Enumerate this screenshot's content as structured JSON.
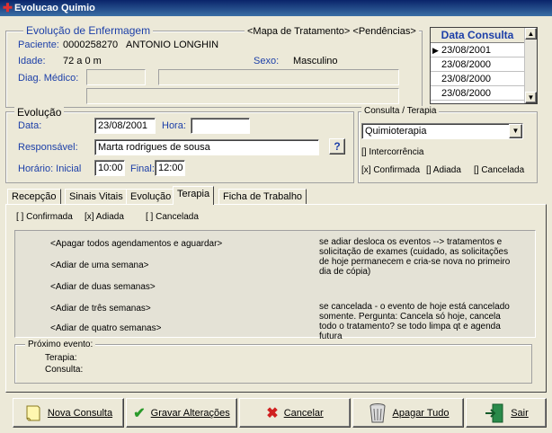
{
  "window": {
    "title": "Evolucao Quimio"
  },
  "header": {
    "section_title": "Evolução de Enfermagem",
    "links": "<Mapa de Tratamento> <Pendências>",
    "patient_label": "Paciente:",
    "patient_id": "0000258270",
    "patient_name": "ANTONIO LONGHIN",
    "age_label": "Idade:",
    "age_value": "72 a 0 m",
    "sex_label": "Sexo:",
    "sex_value": "Masculino",
    "diag_label": "Diag. Médico:"
  },
  "data_consulta": {
    "header": "Data Consulta",
    "rows": [
      "23/08/2001",
      "23/08/2000",
      "23/08/2000",
      "23/08/2000"
    ]
  },
  "evolucao": {
    "legend": "Evolução",
    "data_label": "Data:",
    "data_value": "23/08/2001",
    "hora_label": "Hora:",
    "hora_value": "",
    "responsavel_label": "Responsável:",
    "responsavel_value": "Marta rodrigues de sousa",
    "lookup_label": "?",
    "horario_inicial_label": "Horário: Inicial",
    "horario_inicial_value": "10:00",
    "final_label": "Final:",
    "final_value": "12:00"
  },
  "consulta_terapia": {
    "legend": "Consulta / Terapia",
    "select_value": "Quimioterapia",
    "intercorrencia": "[] Intercorrência",
    "confirmada": "[x] Confirmada",
    "adiada": "[] Adiada",
    "cancelada": "[] Cancelada"
  },
  "tabs": [
    "Recepção",
    "Sinais Vitais",
    "Evolução",
    "Terapia",
    "Ficha de Trabalho"
  ],
  "terapia": {
    "confirmada": "[ ] Confirmada",
    "adiada": "[x] Adiada",
    "cancelada": "[ ] Cancelada",
    "options": [
      "<Apagar todos agendamentos e aguardar>",
      "<Adiar de uma semana>",
      "<Adiar de duas semanas>",
      "<Adiar de três semanas>",
      "<Adiar de quatro semanas>"
    ],
    "note_adiar": "se adiar desloca os eventos --> tratamentos e solicitação de exames (cuidado, as solicitações de hoje permanecem e cria-se nova no primeiro dia de cópia)",
    "note_cancelar": "se cancelada - o evento de hoje está cancelado somente. Pergunta: Cancela só hoje, cancela todo o tratamento? se todo limpa qt e agenda futura",
    "proximo_evento": "Próximo evento:",
    "terapia_label": "Terapia:",
    "consulta_label": "Consulta:"
  },
  "buttons": {
    "nova_consulta": "Nova Consulta",
    "gravar": "Gravar Alterações",
    "cancelar": "Cancelar",
    "apagar": "Apagar Tudo",
    "sair": "Sair"
  }
}
